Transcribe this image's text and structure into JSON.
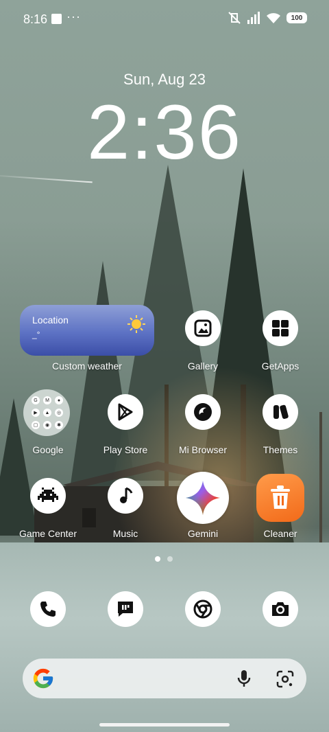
{
  "status_bar": {
    "time": "8:16",
    "overflow": "···",
    "battery": "100",
    "icons": [
      "notification-square-icon",
      "mute-vibrate-icon",
      "signal-icon",
      "wifi-icon",
      "battery-icon"
    ]
  },
  "lockclock": {
    "date": "Sun, Aug 23",
    "time": "2:36"
  },
  "weather_widget": {
    "title": "Location",
    "value": "_°",
    "icon": "sun-icon",
    "label": "Custom weather"
  },
  "apps": {
    "gallery": "Gallery",
    "getapps": "GetApps",
    "google": "Google",
    "play_store": "Play Store",
    "mi_browser": "Mi Browser",
    "themes": "Themes",
    "game_center": "Game Center",
    "music": "Music",
    "gemini": "Gemini",
    "cleaner": "Cleaner"
  },
  "google_folder": {
    "items": [
      "G",
      "M",
      "●",
      "▶",
      "▲",
      "◎",
      "▢",
      "◉",
      "✱"
    ]
  },
  "dock": [
    "phone-icon",
    "messages-icon",
    "chrome-icon",
    "camera-icon"
  ],
  "pages": {
    "count": 2,
    "active": 1
  },
  "colors": {
    "weather_top": "#8e9fd6",
    "weather_bottom": "#3b4ea7",
    "cleaner": "#f26a19"
  }
}
